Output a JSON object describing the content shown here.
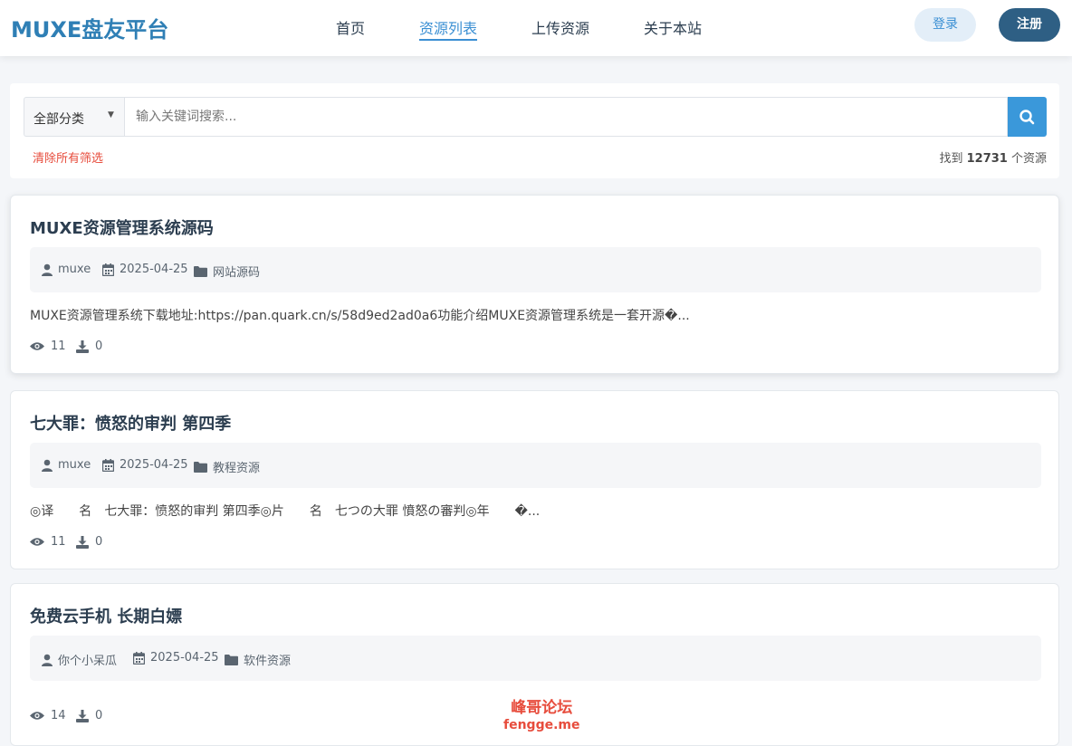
{
  "brand": {
    "logo": "MUXE盘友平台",
    "accent_color": "#3a8fd3",
    "dark_color": "#2e5f84"
  },
  "nav": {
    "items": [
      {
        "label": "首页",
        "active": false
      },
      {
        "label": "资源列表",
        "active": true
      },
      {
        "label": "上传资源",
        "active": false
      },
      {
        "label": "关于本站",
        "active": false
      }
    ],
    "login_label": "登录",
    "register_label": "注册"
  },
  "search": {
    "category_selected": "全部分类",
    "placeholder": "输入关键词搜索...",
    "value": "",
    "button_icon": "search-icon",
    "clear_filters_label": "清除所有筛选",
    "result_prefix": "找到",
    "result_count": "12731",
    "result_suffix": "个资源"
  },
  "resources": [
    {
      "title": "MUXE资源管理系统源码",
      "author": "muxe",
      "date": "2025-04-25",
      "category": "网站源码",
      "description": "MUXE资源管理系统下载地址:https://pan.quark.cn/s/58d9ed2ad0a6功能介绍MUXE资源管理系统是一套开源�...",
      "views": "11",
      "downloads": "0"
    },
    {
      "title": "七大罪：愤怒的审判 第四季",
      "author": "muxe",
      "date": "2025-04-25",
      "category": "教程资源",
      "description": "◎译　　名　七大罪：愤怒的审判 第四季◎片　　名　七つの大罪 憤怒の審判◎年　　�...",
      "views": "11",
      "downloads": "0"
    },
    {
      "title": "免费云手机 长期白嫖",
      "author": "你个小呆瓜",
      "date": "2025-04-25",
      "category": "软件资源",
      "description": "",
      "views": "14",
      "downloads": "0"
    }
  ],
  "watermark": {
    "line1": "峰哥论坛",
    "line2": "fengge.me"
  }
}
